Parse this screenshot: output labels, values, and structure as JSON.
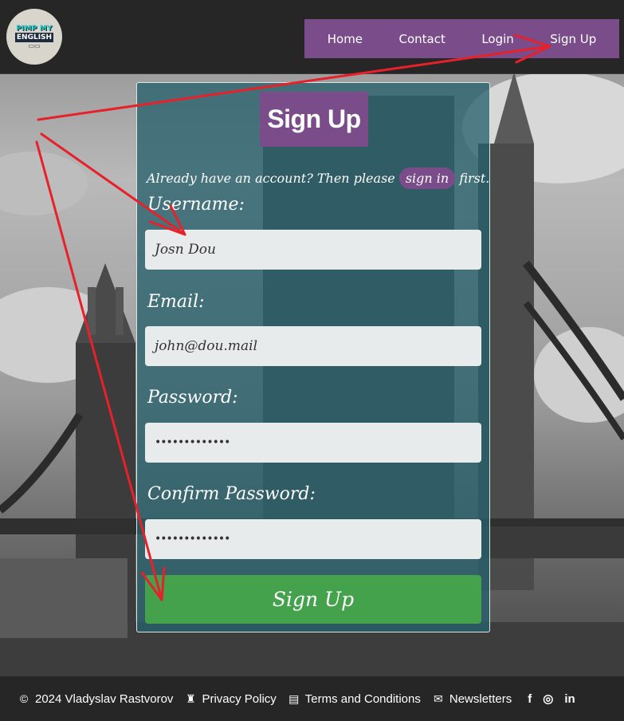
{
  "header": {
    "logo": {
      "line1": "PIMP MY",
      "line2": "ENGLISH"
    },
    "nav": [
      {
        "label": "Home"
      },
      {
        "label": "Contact"
      },
      {
        "label": "Login"
      },
      {
        "label": "Sign Up"
      }
    ]
  },
  "form": {
    "title": "Sign Up",
    "already_text_before": "Already have an account? Then please",
    "signin_link": "sign in",
    "already_text_after": "first.",
    "username": {
      "label": "Username:",
      "value": "Josn Dou"
    },
    "email": {
      "label": "Email:",
      "value": "john@dou.mail"
    },
    "password": {
      "label": "Password:",
      "value": "•••••••••••••"
    },
    "confirm_password": {
      "label": "Confirm Password:",
      "value": "•••••••••••••"
    },
    "submit_label": "Sign Up"
  },
  "footer": {
    "copyright": "2024 Vladyslav Rastvorov",
    "privacy": "Privacy Policy",
    "terms": "Terms and Conditions",
    "newsletters": "Newsletters",
    "social": [
      "f",
      "ig",
      "in"
    ]
  },
  "colors": {
    "accent_purple": "#7a4d8a",
    "card_teal": "#28626c",
    "submit_green": "#44a24d",
    "annotation_red": "#e8202a"
  }
}
